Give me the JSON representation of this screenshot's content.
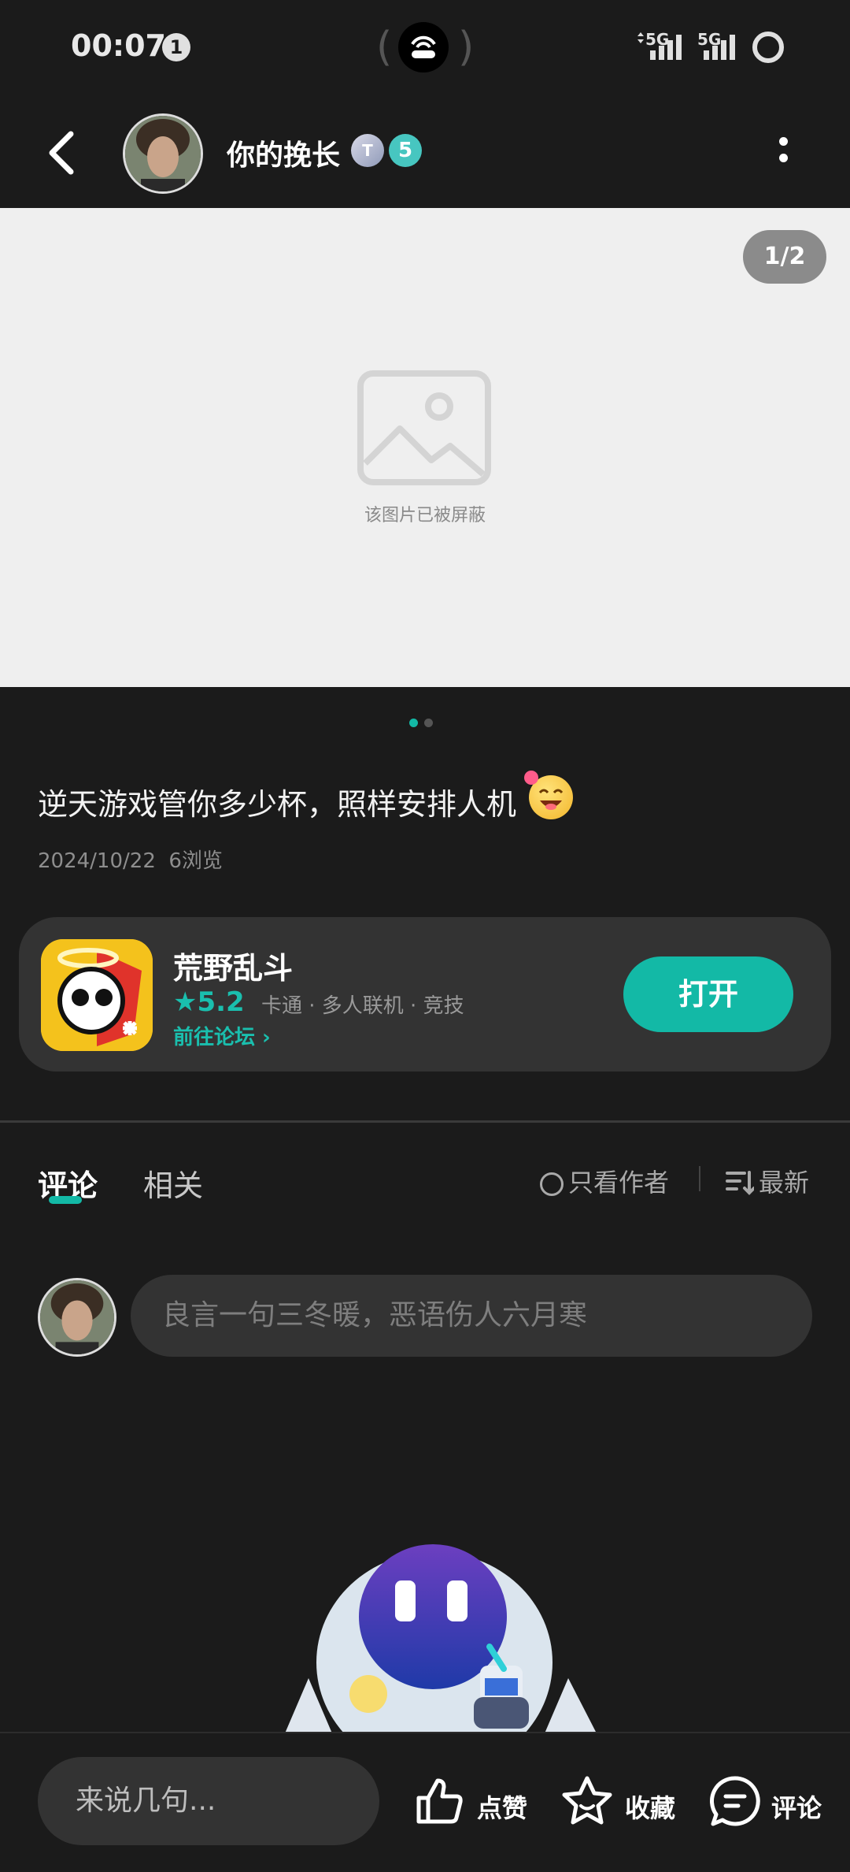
{
  "status_bar": {
    "time": "00:07",
    "notification_count": "1",
    "signal_1": "5G",
    "signal_2": "5G"
  },
  "header": {
    "username": "你的挽长",
    "badge_a": "T",
    "badge_b": "5"
  },
  "image": {
    "counter": "1/2",
    "blocked_text": "该图片已被屏蔽"
  },
  "post": {
    "text": "逆天游戏管你多少杯，照样安排人机",
    "date": "2024/10/22",
    "views": "6浏览"
  },
  "game": {
    "name": "荒野乱斗",
    "rating": "★5.2",
    "tags": "卡通 · 多人联机 · 竞技",
    "forum_link": "前往论坛 ›",
    "open_label": "打开"
  },
  "tabs": {
    "comments": "评论",
    "related": "相关",
    "only_author": "只看作者",
    "sort": "最新"
  },
  "comment_input": {
    "placeholder": "良言一句三冬暖，恶语伤人六月寒"
  },
  "bottom_bar": {
    "say_placeholder": "来说几句...",
    "like": "点赞",
    "favorite": "收藏",
    "comment": "评论"
  },
  "colors": {
    "accent": "#13b9a6",
    "background": "#1b1b1b",
    "card": "#333333"
  }
}
